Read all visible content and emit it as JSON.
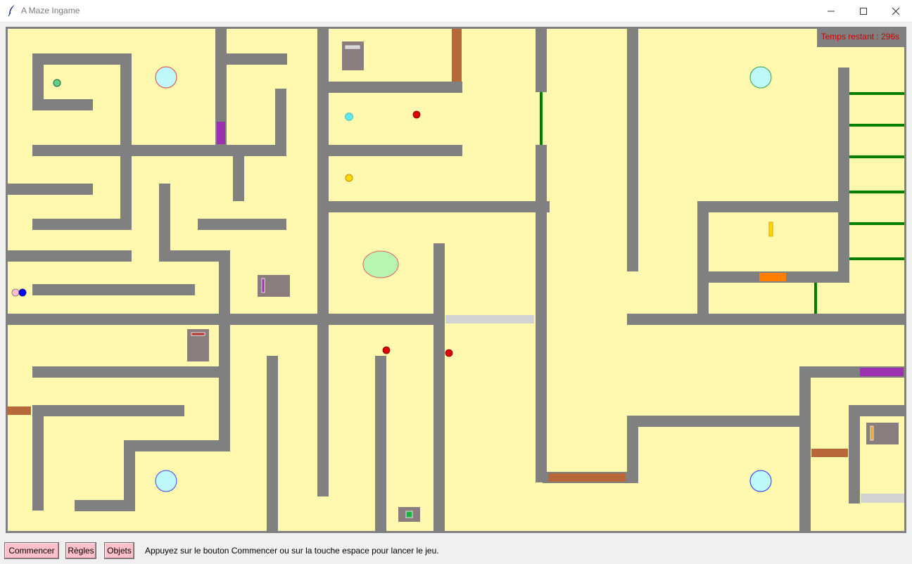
{
  "window": {
    "title": "A Maze Ingame",
    "app_icon": "feather-icon",
    "controls": [
      "minimize-icon",
      "maximize-icon",
      "close-icon"
    ]
  },
  "game": {
    "timer_text": "Temps restant : 296s",
    "colors": {
      "floor": "#fff9b0",
      "wall": "#808080",
      "timer": "#cc0000",
      "wooden_door": "#b8673a",
      "green_barrier": "#007f00",
      "purple_door": "#9b30b0",
      "orange_door": "#ff8000",
      "grey_door": "#d3d3d3",
      "teleporter": "#bff8f8",
      "player": "#0000ff",
      "start_marker": "#ffc0cb",
      "enemy": "#dd0000"
    },
    "pickups": [
      "green-orb",
      "cyan-orb",
      "yellow-coin",
      "red-orbs",
      "chests",
      "keys"
    ]
  },
  "toolbar": {
    "start_label": "Commencer",
    "rules_label": "Règles",
    "items_label": "Objets",
    "status_message": "Appuyez sur le bouton Commencer ou sur la touche espace pour lancer le jeu."
  }
}
